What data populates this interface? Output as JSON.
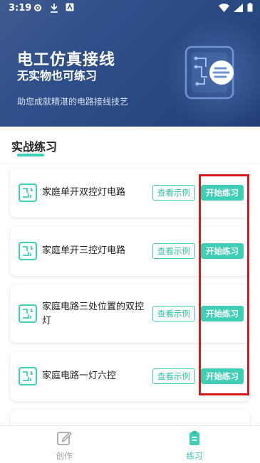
{
  "status_bar": {
    "time": "3:19"
  },
  "hero": {
    "title": "电工仿真接线",
    "subtitle": "无实物也可练习",
    "description": "助您成就精湛的电路接线技艺"
  },
  "section": {
    "title": "实战练习"
  },
  "cards": [
    {
      "title": "家庭单开双控灯电路",
      "example_label": "查看示例",
      "start_label": "开始练习"
    },
    {
      "title": "家庭单开三控灯电路",
      "example_label": "查看示例",
      "start_label": "开始练习"
    },
    {
      "title": "家庭电路三处位置的双控灯",
      "example_label": "查看示例",
      "start_label": "开始练习"
    },
    {
      "title": "家庭电路一灯六控",
      "example_label": "查看示例",
      "start_label": "开始练习"
    }
  ],
  "tabbar": {
    "create_label": "创作",
    "practice_label": "练习"
  },
  "colors": {
    "accent": "#3fcfb6",
    "hero_bg": "#2f4f8a",
    "highlight": "#d61a1a"
  }
}
